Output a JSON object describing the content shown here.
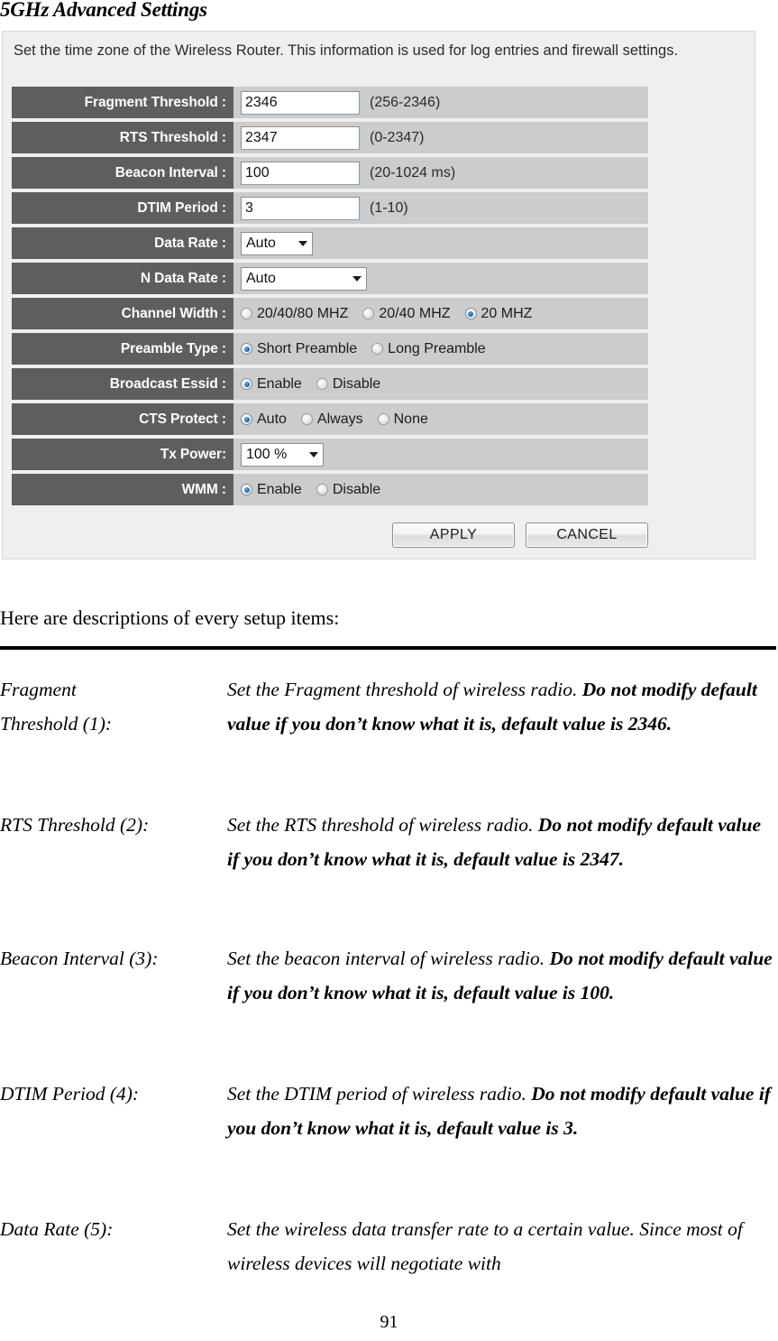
{
  "document": {
    "title": "5GHz Advanced Settings",
    "intro": "Here are descriptions of every setup items:",
    "page_number": "91"
  },
  "router_ui": {
    "note": "Set the time zone of the Wireless Router. This information is used for log entries and firewall settings.",
    "rows": [
      {
        "label": "Fragment Threshold :",
        "type": "text",
        "value": "2346",
        "hint": "(256-2346)"
      },
      {
        "label": "RTS Threshold :",
        "type": "text",
        "value": "2347",
        "hint": "(0-2347)"
      },
      {
        "label": "Beacon Interval :",
        "type": "text",
        "value": "100",
        "hint": "(20-1024 ms)"
      },
      {
        "label": "DTIM Period :",
        "type": "text",
        "value": "3",
        "hint": "(1-10)"
      },
      {
        "label": "Data Rate :",
        "type": "select",
        "value": "Auto",
        "width": "small"
      },
      {
        "label": "N Data Rate :",
        "type": "select",
        "value": "Auto",
        "width": "large"
      },
      {
        "label": "Channel Width :",
        "type": "radio",
        "options": [
          {
            "label": "20/40/80 MHZ",
            "selected": false
          },
          {
            "label": "20/40 MHZ",
            "selected": false
          },
          {
            "label": "20 MHZ",
            "selected": true
          }
        ]
      },
      {
        "label": "Preamble Type :",
        "type": "radio",
        "options": [
          {
            "label": "Short Preamble",
            "selected": true
          },
          {
            "label": "Long Preamble",
            "selected": false
          }
        ]
      },
      {
        "label": "Broadcast Essid :",
        "type": "radio",
        "options": [
          {
            "label": "Enable",
            "selected": true
          },
          {
            "label": "Disable",
            "selected": false
          }
        ]
      },
      {
        "label": "CTS Protect :",
        "type": "radio",
        "options": [
          {
            "label": "Auto",
            "selected": true
          },
          {
            "label": "Always",
            "selected": false
          },
          {
            "label": "None",
            "selected": false
          }
        ]
      },
      {
        "label": "Tx Power:",
        "type": "select",
        "value": "100 %",
        "width": "tx"
      },
      {
        "label": "WMM :",
        "type": "radio",
        "options": [
          {
            "label": "Enable",
            "selected": true
          },
          {
            "label": "Disable",
            "selected": false
          }
        ]
      }
    ],
    "buttons": {
      "apply": "APPLY",
      "cancel": "CANCEL"
    }
  },
  "descriptions": [
    {
      "term_lines": [
        "Fragment",
        "Threshold (1):"
      ],
      "desc_plain": "Set the Fragment threshold of wireless radio. ",
      "desc_bold": "Do not modify default value if you don’t know what it is, default value is 2346."
    },
    {
      "term_lines": [
        "RTS Threshold (2):"
      ],
      "desc_plain": "Set the RTS threshold of wireless radio. ",
      "desc_bold": "Do not modify default value if you don’t know what it is, default value is 2347."
    },
    {
      "term_lines": [
        "Beacon Interval (3):"
      ],
      "desc_plain": "Set the beacon interval of wireless radio. ",
      "desc_bold": "Do not modify default value if you don’t know what it is, default value is 100."
    },
    {
      "term_lines": [
        "DTIM Period (4):"
      ],
      "desc_plain": "Set the DTIM period of wireless radio. ",
      "desc_bold": "Do not modify default value if you don’t know what it is, default value is 3."
    },
    {
      "term_lines": [
        "Data Rate (5):"
      ],
      "desc_plain": "Set the wireless data transfer rate to a certain value. Since most of wireless devices will negotiate with",
      "desc_bold": ""
    }
  ],
  "colors": {
    "panel_bg": "#efefef",
    "label_bg": "#5e5e5e",
    "field_bg": "#cccccc",
    "radio_accent": "#1a6fc4"
  }
}
